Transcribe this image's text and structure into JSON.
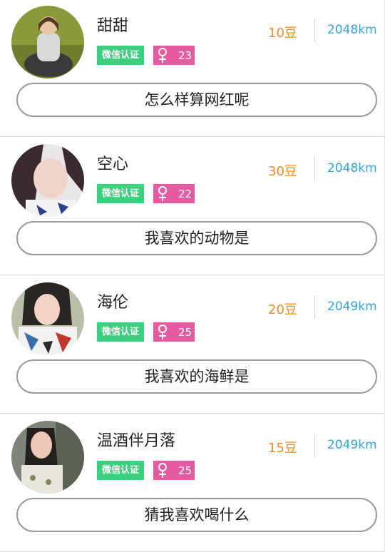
{
  "cards": [
    {
      "name": "甜甜",
      "wechat_label": "微信认证",
      "age": "23",
      "beans": "10豆",
      "distance": "2048km",
      "question": "怎么样算网红呢",
      "gender_icon": "female-icon",
      "avatar_icon": "user-avatar"
    },
    {
      "name": "空心",
      "wechat_label": "微信认证",
      "age": "22",
      "beans": "30豆",
      "distance": "2048km",
      "question": "我喜欢的动物是",
      "gender_icon": "female-icon",
      "avatar_icon": "user-avatar"
    },
    {
      "name": "海伦",
      "wechat_label": "微信认证",
      "age": "25",
      "beans": "20豆",
      "distance": "2049km",
      "question": "我喜欢的海鲜是",
      "gender_icon": "female-icon",
      "avatar_icon": "user-avatar"
    },
    {
      "name": "温酒伴月落",
      "wechat_label": "微信认证",
      "age": "25",
      "beans": "15豆",
      "distance": "2049km",
      "question": "猜我喜欢喝什么",
      "gender_icon": "female-icon",
      "avatar_icon": "user-avatar"
    }
  ],
  "colors": {
    "wechat_badge": "#3ccf7e",
    "gender_badge": "#e65aa1",
    "beans": "#f08a1d",
    "distance": "#2fa7de"
  }
}
